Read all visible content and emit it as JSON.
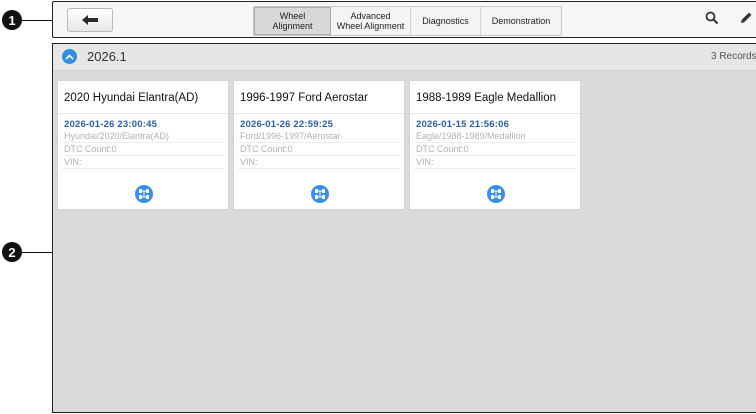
{
  "callouts": [
    "1",
    "2"
  ],
  "toolbar": {
    "back_icon": "back-arrow-icon",
    "tabs": [
      {
        "label": "Wheel Alignment",
        "active": true
      },
      {
        "label_line1": "Advanced",
        "label_line2": "Wheel Alignment",
        "active": false
      },
      {
        "label": "Diagnostics",
        "active": false
      },
      {
        "label": "Demonstration",
        "active": false
      }
    ],
    "search_icon": "search-icon",
    "edit_icon": "pencil-icon"
  },
  "group": {
    "title": "2026.1",
    "records": "3 Records",
    "collapse_icon": "chevron-up-icon"
  },
  "cards": [
    {
      "title": "2020 Hyundai Elantra(AD)",
      "date": "2026-01-26 23:00:45",
      "path": "Hyundai/2020/Elantra(AD)",
      "dtc": "DTC Count:0",
      "vin": "VIN:",
      "action_icon": "wheel-alignment-icon"
    },
    {
      "title": "1996-1997 Ford Aerostar",
      "date": "2026-01-26 22:59:25",
      "path": "Ford/1996-1997/Aerostar",
      "dtc": "DTC Count:0",
      "vin": "VIN:",
      "action_icon": "wheel-alignment-icon"
    },
    {
      "title": "1988-1989 Eagle Medallion",
      "date": "2026-01-15 21:56:06",
      "path": "Eagle/1988-1989/Medallion",
      "dtc": "DTC Count:0",
      "vin": "VIN:",
      "action_icon": "wheel-alignment-icon"
    }
  ],
  "colors": {
    "accent": "#2f8fe0",
    "date_text": "#2b5e9e",
    "content_bg": "#dadada"
  }
}
